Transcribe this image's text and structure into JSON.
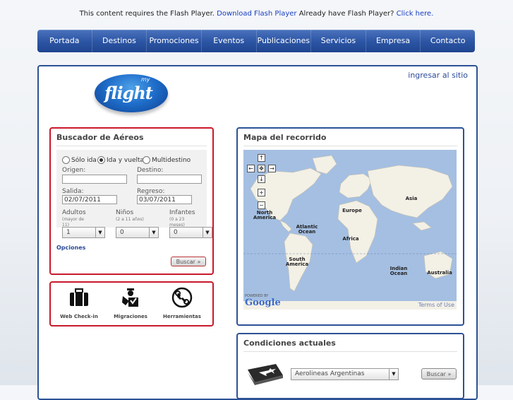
{
  "flash": {
    "text": "This content requires the Flash Player.",
    "download_link": "Download Flash Player",
    "question": "Already have Flash Player?",
    "click_link": "Click here."
  },
  "nav": [
    "Portada",
    "Destinos",
    "Promociones",
    "Eventos",
    "Publicaciones",
    "Servicios",
    "Empresa",
    "Contacto"
  ],
  "login_link": "ingresar al sitio",
  "logo": {
    "small": "my",
    "main": "flight"
  },
  "search": {
    "title": "Buscador de Aéreos",
    "trip_types": [
      "Sólo ida",
      "Ida y vuelta",
      "Multidestino"
    ],
    "selected_trip_type": "Ida y vuelta",
    "origin_label": "Origen:",
    "destination_label": "Destino:",
    "origin_value": "",
    "destination_value": "",
    "departure_label": "Salida:",
    "departure_value": "02/07/2011",
    "return_label": "Regreso:",
    "return_value": "03/07/2011",
    "adults_label": "Adultos",
    "adults_note": "(mayor de 11)",
    "adults_value": "1",
    "children_label": "Niños",
    "children_note": "(2 a 11 años)",
    "children_value": "0",
    "infants_label": "Infantes",
    "infants_note": "(0 a 23 meses)",
    "infants_value": "0",
    "options_link": "Opciones",
    "search_button": "Buscar »"
  },
  "tools": [
    {
      "label": "Web Check-in",
      "icon": "briefcase-icon"
    },
    {
      "label": "Migraciones",
      "icon": "immigration-officer-icon"
    },
    {
      "label": "Herramientas",
      "icon": "wrench-icon"
    }
  ],
  "map": {
    "title": "Mapa del recorrido",
    "labels": {
      "north_america": "North America",
      "europe": "Europe",
      "asia": "Asia",
      "atlantic": "Atlantic Ocean",
      "africa": "Africa",
      "south_america": "South America",
      "indian": "Indian Ocean",
      "australia": "Australia"
    },
    "powered_small": "POWERED BY",
    "powered_brand": "Google",
    "terms": "Terms of Use",
    "controls": {
      "up": "↑",
      "left": "←",
      "center": "✥",
      "right": "→",
      "down": "↓",
      "zoom_in": "+",
      "zoom_out": "−"
    }
  },
  "conditions": {
    "title": "Condiciones actuales",
    "airline": "Aerolineas Argentinas",
    "search_button": "Buscar »"
  },
  "colors": {
    "nav_blue": "#2b54a3",
    "accent_red": "#c8192b",
    "panel_border": "#2c5296",
    "map_water": "#a4bfe2",
    "map_land": "#f3f0e6"
  }
}
